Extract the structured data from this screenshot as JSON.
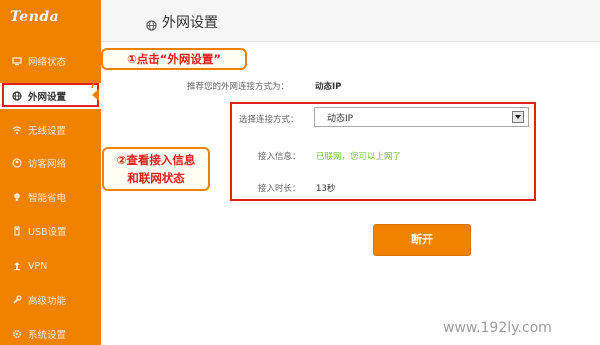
{
  "sidebar": {
    "logo": "Tenda",
    "items": [
      {
        "label": "网络状态",
        "icon": "monitor-icon"
      },
      {
        "label": "外网设置",
        "icon": "globe-icon",
        "active": true
      },
      {
        "label": "无线设置",
        "icon": "wifi-icon"
      },
      {
        "label": "访客网络",
        "icon": "guest-icon"
      },
      {
        "label": "智能省电",
        "icon": "bulb-icon"
      },
      {
        "label": "USB设置",
        "icon": "usb-icon"
      },
      {
        "label": "VPN",
        "icon": "vpn-icon"
      },
      {
        "label": "高级功能",
        "icon": "wrench-icon"
      },
      {
        "label": "系统设置",
        "icon": "gear-icon"
      }
    ]
  },
  "header": {
    "title": "外网设置",
    "icon": "globe-icon"
  },
  "callouts": {
    "step1": "①点击“外网设置”",
    "step2_line1": "②查看接入信息",
    "step2_line2": "和联网状态"
  },
  "content": {
    "recommend_label": "推荐您的外网连接方式为：",
    "recommend_value": "动态IP",
    "mode_label": "选择连接方式：",
    "mode_value": "动态IP",
    "access_label": "接入信息：",
    "access_value": "已联网，您可以上网了",
    "duration_label": "接入时长：",
    "duration_value": "13秒",
    "disconnect_label": "断开"
  },
  "watermark": "www.192ly.com",
  "colors": {
    "accent": "#f08200",
    "highlight": "#e0201a",
    "success": "#7ac143"
  }
}
